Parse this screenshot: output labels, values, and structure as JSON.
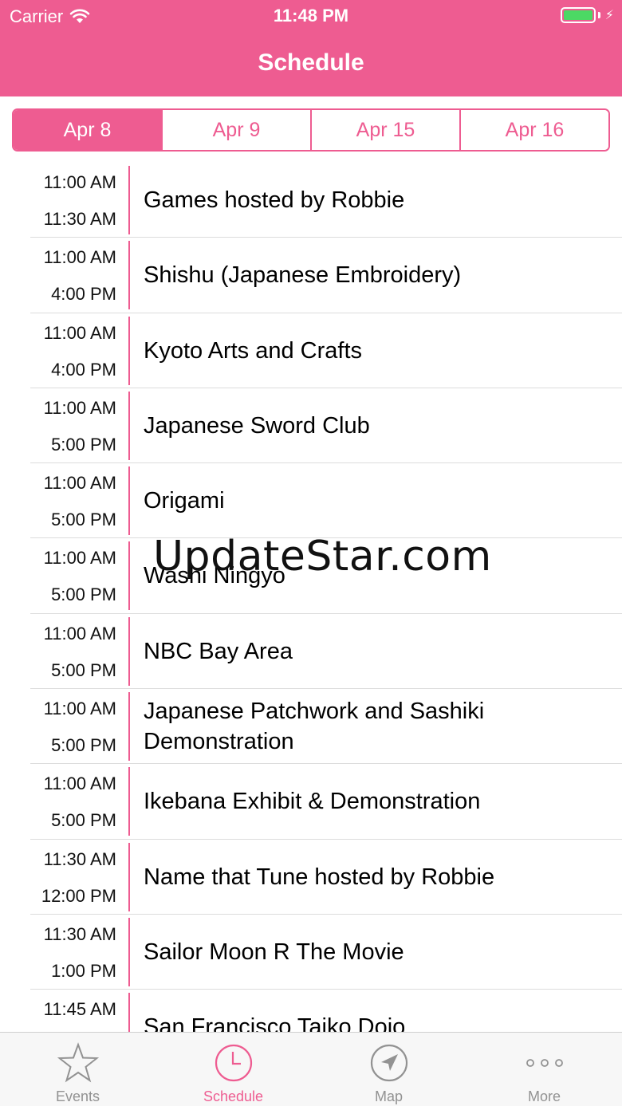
{
  "status_bar": {
    "carrier": "Carrier",
    "time": "11:48 PM"
  },
  "nav": {
    "title": "Schedule"
  },
  "segments": [
    {
      "label": "Apr 8",
      "active": true
    },
    {
      "label": "Apr 9",
      "active": false
    },
    {
      "label": "Apr 15",
      "active": false
    },
    {
      "label": "Apr 16",
      "active": false
    }
  ],
  "events": [
    {
      "start": "11:00 AM",
      "end": "11:30 AM",
      "title": "Games hosted by Robbie"
    },
    {
      "start": "11:00 AM",
      "end": "4:00 PM",
      "title": "Shishu (Japanese Embroidery)"
    },
    {
      "start": "11:00 AM",
      "end": "4:00 PM",
      "title": "Kyoto Arts and Crafts"
    },
    {
      "start": "11:00 AM",
      "end": "5:00 PM",
      "title": "Japanese Sword Club"
    },
    {
      "start": "11:00 AM",
      "end": "5:00 PM",
      "title": "Origami"
    },
    {
      "start": "11:00 AM",
      "end": "5:00 PM",
      "title": "Washi Ningyo"
    },
    {
      "start": "11:00 AM",
      "end": "5:00 PM",
      "title": "NBC Bay Area"
    },
    {
      "start": "11:00 AM",
      "end": "5:00 PM",
      "title": "Japanese Patchwork and Sashiki Demonstration"
    },
    {
      "start": "11:00 AM",
      "end": "5:00 PM",
      "title": "Ikebana Exhibit & Demonstration"
    },
    {
      "start": "11:30 AM",
      "end": "12:00 PM",
      "title": "Name that Tune hosted by Robbie"
    },
    {
      "start": "11:30 AM",
      "end": "1:00 PM",
      "title": "Sailor Moon R The Movie"
    },
    {
      "start": "11:45 AM",
      "end": "",
      "title": "San Francisco Taiko Dojo"
    }
  ],
  "watermark": "UpdateStar.com",
  "tabs": [
    {
      "label": "Events",
      "icon": "star-icon",
      "active": false
    },
    {
      "label": "Schedule",
      "icon": "clock-icon",
      "active": true
    },
    {
      "label": "Map",
      "icon": "location-arrow-icon",
      "active": false
    },
    {
      "label": "More",
      "icon": "more-dots-icon",
      "active": false
    }
  ],
  "colors": {
    "accent": "#EE5C91",
    "tab_inactive": "#929292",
    "battery": "#4CD964"
  }
}
